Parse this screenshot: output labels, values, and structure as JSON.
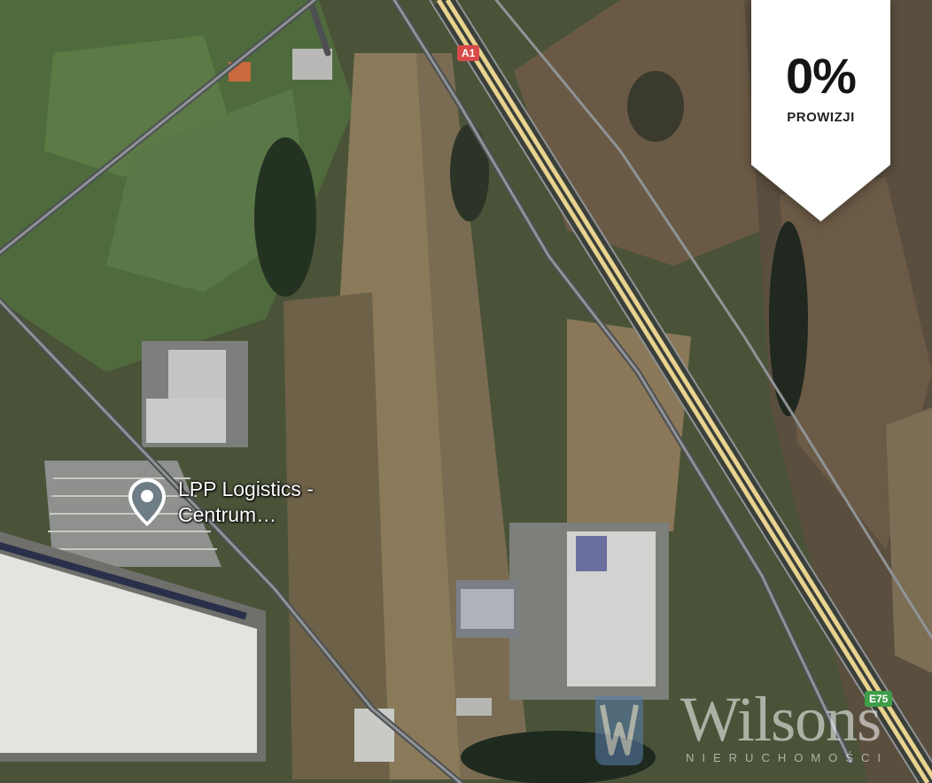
{
  "map": {
    "roads": [
      {
        "name": "A1",
        "color": "#d84a4a"
      },
      {
        "name": "E75",
        "color": "#3f9d4a"
      }
    ],
    "poi": {
      "label_line1": "LPP Logistics -",
      "label_line2": "Centrum…"
    }
  },
  "badge": {
    "headline": "0%",
    "caption": "PROWIZJI"
  },
  "watermark": {
    "brand": "Wilsons",
    "tagline": "NIERUCHOMOŚCI"
  }
}
